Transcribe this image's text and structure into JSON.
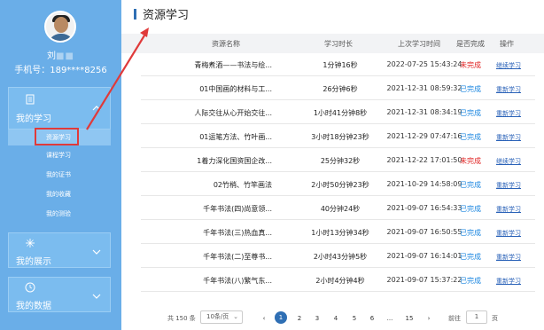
{
  "sidebar": {
    "user_name": "刘",
    "user_name_masked": "■■",
    "phone": "手机号：189****8256",
    "groups": [
      {
        "label": "我的学习"
      },
      {
        "label": "我的展示"
      },
      {
        "label": "我的数据"
      }
    ],
    "sub_items": [
      {
        "label": "资源学习",
        "active": true
      },
      {
        "label": "课程学习"
      },
      {
        "label": "我的证书"
      },
      {
        "label": "我的收藏"
      },
      {
        "label": "我的测验"
      }
    ]
  },
  "main": {
    "title": "资源学习",
    "columns": [
      "资源名称",
      "学习时长",
      "上次学习时间",
      "是否完成",
      "操作"
    ],
    "rows": [
      {
        "name": "青梅煮酒——书法与绘...",
        "duration": "1分钟16秒",
        "last": "2022-07-25 15:43:24",
        "status": "未完成",
        "status_done": false,
        "op": "继续学习"
      },
      {
        "name": "01中国画的材料与工...",
        "duration": "26分钟6秒",
        "last": "2021-12-31 08:59:32",
        "status": "已完成",
        "status_done": true,
        "op": "重新学习"
      },
      {
        "name": "人际交往从心开始交往...",
        "duration": "1小时41分钟8秒",
        "last": "2021-12-31 08:34:19",
        "status": "已完成",
        "status_done": true,
        "op": "重新学习"
      },
      {
        "name": "01运笔方法、竹叶画...",
        "duration": "3小时18分钟23秒",
        "last": "2021-12-29 07:47:16",
        "status": "已完成",
        "status_done": true,
        "op": "重新学习"
      },
      {
        "name": "1着力深化国资国企改...",
        "duration": "25分钟32秒",
        "last": "2021-12-22 17:01:50",
        "status": "未完成",
        "status_done": false,
        "op": "继续学习"
      },
      {
        "name": "02竹梢、竹竿画法",
        "duration": "2小时50分钟23秒",
        "last": "2021-10-29 14:58:09",
        "status": "已完成",
        "status_done": true,
        "op": "重新学习"
      },
      {
        "name": "千年书法(四)尚意领...",
        "duration": "40分钟24秒",
        "last": "2021-09-07 16:54:33",
        "status": "已完成",
        "status_done": true,
        "op": "重新学习"
      },
      {
        "name": "千年书法(三)热血真...",
        "duration": "1小时13分钟34秒",
        "last": "2021-09-07 16:50:55",
        "status": "已完成",
        "status_done": true,
        "op": "重新学习"
      },
      {
        "name": "千年书法(二)至尊书...",
        "duration": "2小时43分钟5秒",
        "last": "2021-09-07 16:14:01",
        "status": "已完成",
        "status_done": true,
        "op": "重新学习"
      },
      {
        "name": "千年书法(八)繁气东...",
        "duration": "2小时4分钟4秒",
        "last": "2021-09-07 15:37:22",
        "status": "已完成",
        "status_done": true,
        "op": "重新学习"
      }
    ]
  },
  "pagination": {
    "total": "共 150 条",
    "page_size": "10条/页",
    "pages": [
      "1",
      "2",
      "3",
      "4",
      "5",
      "6",
      "...",
      "15"
    ],
    "current": "1",
    "prev": "‹",
    "next": "›",
    "goto_prefix": "前往",
    "goto_value": "1",
    "goto_suffix": "页"
  },
  "colors": {
    "sidebar": "#6aaee8",
    "accent": "#2f6fb4",
    "done": "#1a86e0",
    "not_done": "#e02222",
    "annotation": "#e03a3a"
  }
}
